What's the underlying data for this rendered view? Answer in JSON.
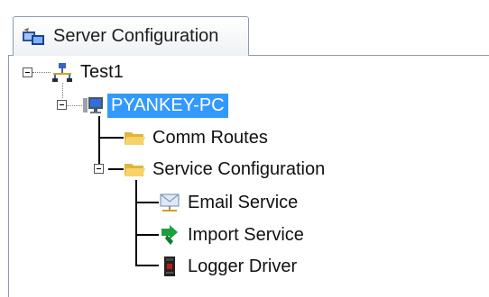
{
  "tab": {
    "label": "Server Configuration"
  },
  "tree": {
    "root": {
      "label": "Test1",
      "icon": "network-icon"
    },
    "computer": {
      "label": "PYANKEY-PC",
      "icon": "computer-icon",
      "selected": true
    },
    "comm_routes": {
      "label": "Comm Routes",
      "icon": "folder-icon"
    },
    "service_configuration": {
      "label": "Service Configuration",
      "icon": "folder-icon"
    },
    "email_service": {
      "label": "Email Service",
      "icon": "email-icon"
    },
    "import_service": {
      "label": "Import Service",
      "icon": "import-icon"
    },
    "logger_driver": {
      "label": "Logger Driver",
      "icon": "logger-icon"
    }
  },
  "colors": {
    "selection": "#3399ff",
    "tab_border": "#8e9aad"
  }
}
